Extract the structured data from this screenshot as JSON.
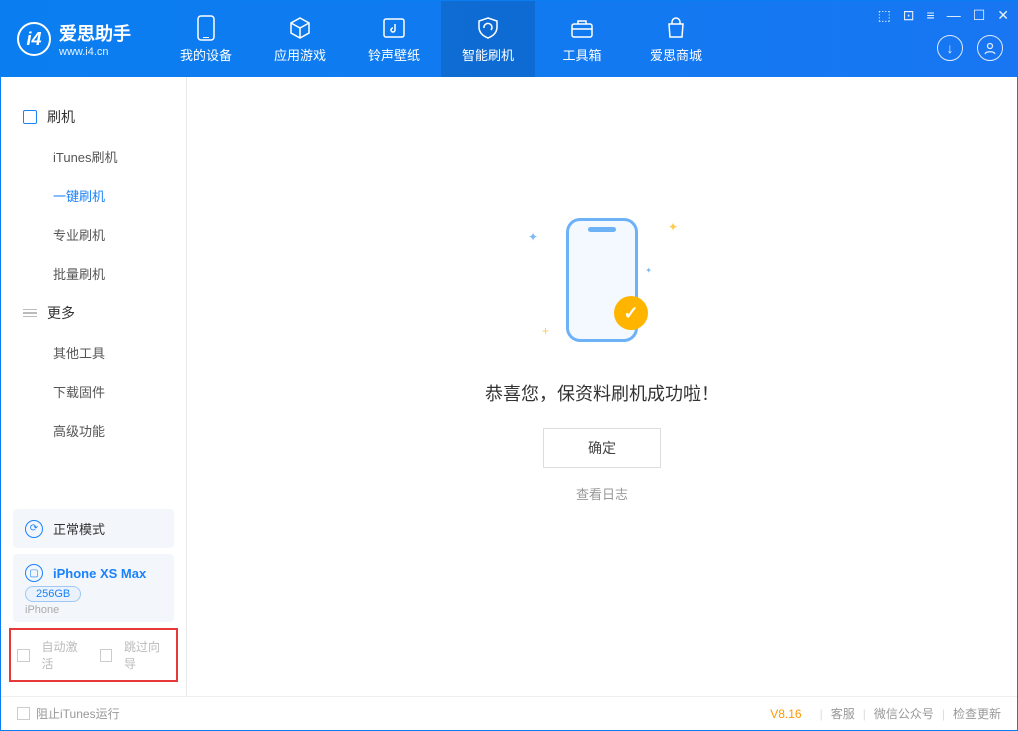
{
  "logo": {
    "name": "爱思助手",
    "url": "www.i4.cn",
    "glyph": "i4"
  },
  "tabs": [
    {
      "label": "我的设备"
    },
    {
      "label": "应用游戏"
    },
    {
      "label": "铃声壁纸"
    },
    {
      "label": "智能刷机"
    },
    {
      "label": "工具箱"
    },
    {
      "label": "爱思商城"
    }
  ],
  "sidebar": {
    "sections": [
      {
        "title": "刷机",
        "items": [
          "iTunes刷机",
          "一键刷机",
          "专业刷机",
          "批量刷机"
        ]
      },
      {
        "title": "更多",
        "items": [
          "其他工具",
          "下载固件",
          "高级功能"
        ]
      }
    ]
  },
  "devices": {
    "mode": "正常模式",
    "name": "iPhone XS Max",
    "capacity": "256GB",
    "sub": "iPhone"
  },
  "options": {
    "auto_activate": "自动激活",
    "skip_guide": "跳过向导"
  },
  "main": {
    "success_text": "恭喜您，保资料刷机成功啦！",
    "confirm": "确定",
    "view_log": "查看日志"
  },
  "footer": {
    "block_itunes": "阻止iTunes运行",
    "version": "V8.16",
    "links": [
      "客服",
      "微信公众号",
      "检查更新"
    ]
  }
}
